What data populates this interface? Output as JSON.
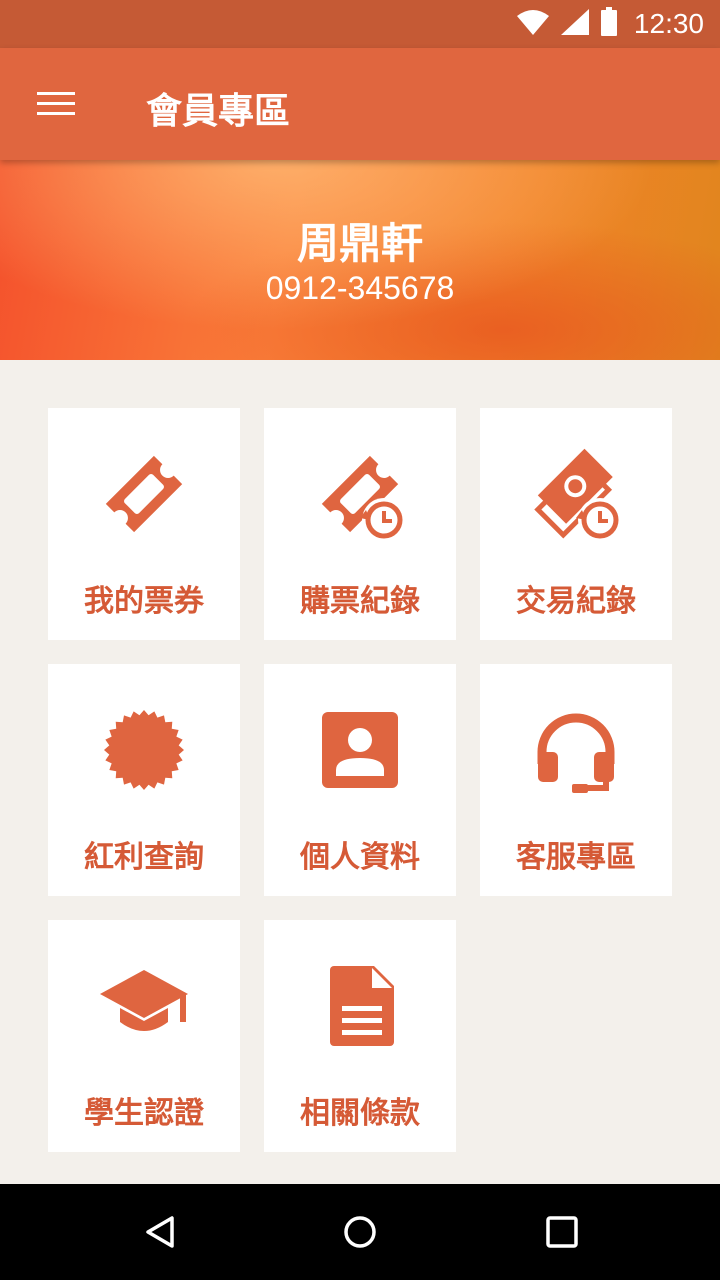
{
  "status_bar": {
    "time": "12:30"
  },
  "app_bar": {
    "title": "會員專區",
    "menu_icon": "menu-icon"
  },
  "profile": {
    "name": "周鼎軒",
    "phone": "0912-345678"
  },
  "menu": [
    {
      "label": "我的票券",
      "icon": "ticket-icon"
    },
    {
      "label": "購票紀錄",
      "icon": "ticket-history-icon"
    },
    {
      "label": "交易紀錄",
      "icon": "transaction-history-icon"
    },
    {
      "label": "紅利查詢",
      "icon": "badge-icon"
    },
    {
      "label": "個人資料",
      "icon": "contact-card-icon"
    },
    {
      "label": "客服專區",
      "icon": "headset-icon"
    },
    {
      "label": "學生認證",
      "icon": "graduation-cap-icon"
    },
    {
      "label": "相關條款",
      "icon": "document-icon"
    }
  ],
  "colors": {
    "accent": "#e0663f",
    "icon": "#df6540",
    "status_bar": "#c55a35",
    "background": "#f3f0eb"
  }
}
